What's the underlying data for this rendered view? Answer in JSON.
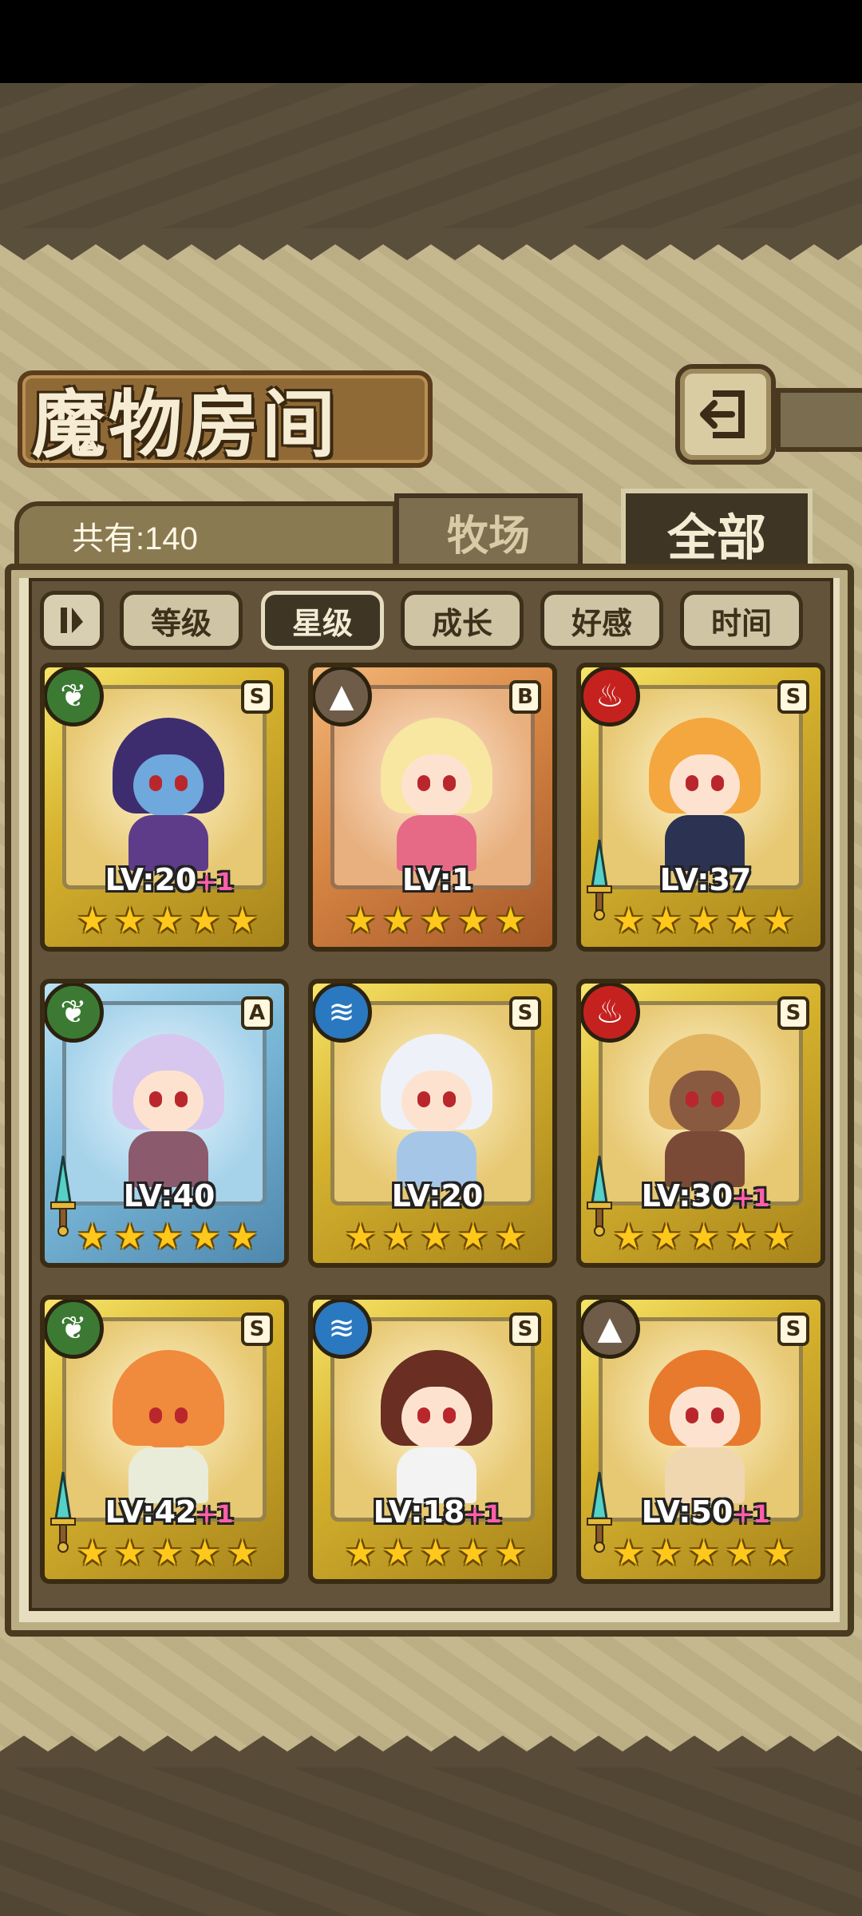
{
  "title": "魔物房间",
  "total_label": "共有:140",
  "tabs": {
    "ranch": "牧场",
    "all": "全部"
  },
  "filters": {
    "toggle_icon": "sort-toggle-icon",
    "items": [
      "等级",
      "星级",
      "成长",
      "好感",
      "时间"
    ],
    "selected": "星级"
  },
  "monsters": [
    {
      "element": "nature",
      "rank": "S",
      "lv_label": "LV:20",
      "plus": "+1",
      "stars": 5,
      "frame": "gold",
      "weapon": false,
      "hair": "#3d2d6f",
      "body": "#5e3c8a",
      "face": "#6fa8dc"
    },
    {
      "element": "earth",
      "rank": "B",
      "lv_label": "LV:1",
      "plus": "",
      "stars": 5,
      "frame": "bronze",
      "weapon": false,
      "hair": "#f7e7a1",
      "body": "#e66a86",
      "face": "#fde3cf"
    },
    {
      "element": "fire",
      "rank": "S",
      "lv_label": "LV:37",
      "plus": "",
      "stars": 5,
      "frame": "gold",
      "weapon": true,
      "hair": "#f4a73e",
      "body": "#2b3252",
      "face": "#fde3cf"
    },
    {
      "element": "nature",
      "rank": "A",
      "lv_label": "LV:40",
      "plus": "",
      "stars": 5,
      "frame": "blue",
      "weapon": true,
      "hair": "#d7c7ef",
      "body": "#8b5a6c",
      "face": "#fde3cf"
    },
    {
      "element": "water",
      "rank": "S",
      "lv_label": "LV:20",
      "plus": "",
      "stars": 5,
      "frame": "gold",
      "weapon": false,
      "hair": "#eef1f7",
      "body": "#a6c6e8",
      "face": "#fde3cf"
    },
    {
      "element": "fire",
      "rank": "S",
      "lv_label": "LV:30",
      "plus": "+1",
      "stars": 5,
      "frame": "gold",
      "weapon": true,
      "hair": "#e2b45f",
      "body": "#7a4a36",
      "face": "#8a5a40"
    },
    {
      "element": "nature",
      "rank": "S",
      "lv_label": "LV:42",
      "plus": "+1",
      "stars": 5,
      "frame": "gold",
      "weapon": true,
      "hair": "#f08a3c",
      "body": "#e9ecd8",
      "face": "#f08a3c"
    },
    {
      "element": "water",
      "rank": "S",
      "lv_label": "LV:18",
      "plus": "+1",
      "stars": 5,
      "frame": "gold",
      "weapon": false,
      "hair": "#6a2e22",
      "body": "#f3f3f3",
      "face": "#fde3cf"
    },
    {
      "element": "earth",
      "rank": "S",
      "lv_label": "LV:50",
      "plus": "+1",
      "stars": 5,
      "frame": "gold",
      "weapon": true,
      "hair": "#e77a2c",
      "body": "#f0d7b0",
      "face": "#fde3cf"
    }
  ],
  "colors": {
    "accent_gold": "#f7e56a",
    "panel": "#e7ddbf",
    "level_plus": "#ff5fa8",
    "star": "#ffc81c"
  }
}
